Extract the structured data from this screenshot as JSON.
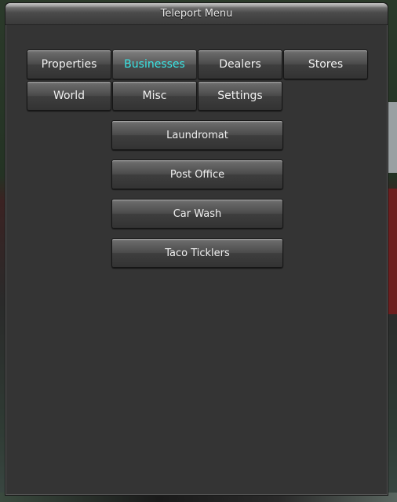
{
  "window": {
    "title": "Teleport Menu"
  },
  "tabs": [
    {
      "label": "Properties",
      "active": false
    },
    {
      "label": "Businesses",
      "active": true
    },
    {
      "label": "Dealers",
      "active": false
    },
    {
      "label": "Stores",
      "active": false
    },
    {
      "label": "World",
      "active": false
    },
    {
      "label": "Misc",
      "active": false
    },
    {
      "label": "Settings",
      "active": false
    }
  ],
  "locations": [
    {
      "label": "Laundromat"
    },
    {
      "label": "Post Office"
    },
    {
      "label": "Car Wash"
    },
    {
      "label": "Taco Ticklers"
    }
  ],
  "colors": {
    "active_tab_text": "#39e6e6",
    "panel_background": "#343434"
  }
}
